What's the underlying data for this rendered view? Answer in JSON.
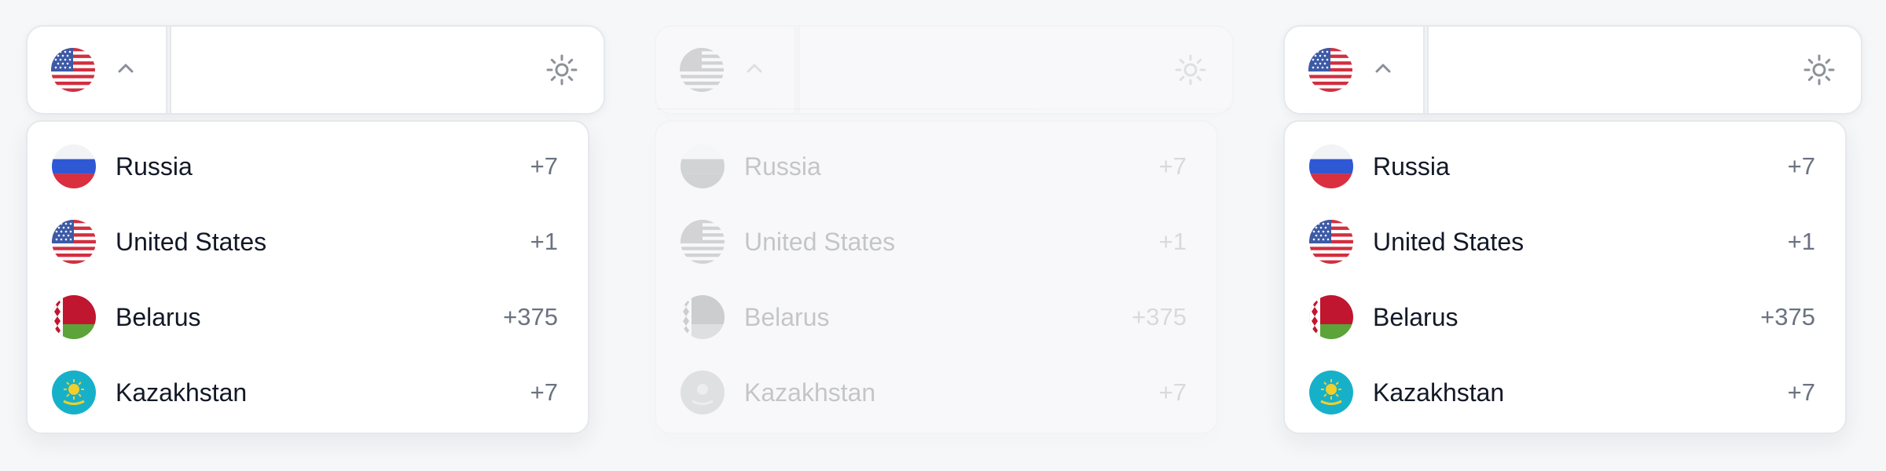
{
  "phone_picker": {
    "input": {
      "value": "",
      "placeholder": ""
    },
    "selected_country": {
      "name": "United States",
      "code": "+1",
      "flag": "us-flag-icon"
    },
    "icons": {
      "chevron": "chevron-up-icon",
      "theme": "sun-icon"
    },
    "countries": [
      {
        "name": "Russia",
        "code": "+7",
        "flag": "ru-flag-icon"
      },
      {
        "name": "United States",
        "code": "+1",
        "flag": "us-flag-icon"
      },
      {
        "name": "Belarus",
        "code": "+375",
        "flag": "by-flag-icon"
      },
      {
        "name": "Kazakhstan",
        "code": "+7",
        "flag": "kz-flag-icon"
      }
    ],
    "colors": {
      "text": "#121826",
      "muted": "#6b7280",
      "border": "#e6e8ec",
      "background": "#f6f7f9"
    }
  }
}
